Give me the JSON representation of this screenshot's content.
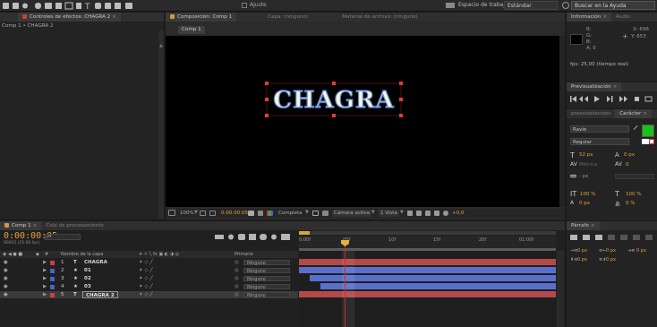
{
  "menubar": {
    "workspace_label": "Espacio de trabajo:",
    "workspace_value": "Estándar",
    "snap_label": "Ajuste",
    "search_placeholder": "Buscar en la Ayuda"
  },
  "effects_panel": {
    "tab_label": "Controles de efectos: CHAGRA 2",
    "breadcrumb": "Comp 1 • CHAGRA 2"
  },
  "composition_panel": {
    "tab_label": "Composición: Comp 1",
    "layer_tab": "Capa: (ninguno)",
    "footage_tab": "Material de archivo: (ninguno)",
    "comp_button": "Comp 1",
    "canvas_text": "CHAGRA",
    "toolbar": {
      "zoom": "100%",
      "timecode": "0:00:00:05",
      "resolution": "Completa",
      "camera": "Cámara activa",
      "views": "1 Vista",
      "exposure": "+0,0"
    }
  },
  "info_panel": {
    "tab_label": "Información",
    "audio_tab": "Audio",
    "r": "R:",
    "g": "G:",
    "b": "B:",
    "a": "A: 0",
    "x": "X: 696",
    "y": "Y: 653",
    "fps": "fps: 25,00 (tiempo real)"
  },
  "preview_panel": {
    "tab_label": "Previsualización"
  },
  "character_panel": {
    "tab_left": "preestablecidos",
    "tab_label": "Carácter",
    "font": "Ravie",
    "style": "Regular",
    "size": "52 px",
    "leading": "0 px",
    "kerning": "Métrica",
    "tracking": "0",
    "stroke": "- px",
    "vscale": "100 %",
    "hscale": "100 %",
    "baseline": "0 px",
    "tsume": "0 %",
    "fill_color": "#19c119"
  },
  "paragraph_panel": {
    "tab_label": "Párrafo",
    "indent_left": "0 px",
    "indent_right": "0 px",
    "indent_first": "0 px",
    "space_before": "0 px",
    "space_after": "0 px"
  },
  "timeline": {
    "tab_label": "Comp 1",
    "queue_tab": "Cola de procesamiento",
    "timecode": "0:00:00:05",
    "fps": "00005 (25.00 fps)",
    "col_name": "Nombre de la capa",
    "col_parent": "Primario",
    "ruler": [
      "0:00f",
      "05f",
      "10f",
      "15f",
      "20f",
      "01:00f"
    ],
    "layers": [
      {
        "num": "1",
        "name": "CHAGRA",
        "parent": "Ninguno",
        "color": "#c94040",
        "bar_color": "#b34a4a"
      },
      {
        "num": "2",
        "name": "01",
        "parent": "Ninguno",
        "color": "#4a62c9",
        "bar_color": "#5a6fcc"
      },
      {
        "num": "3",
        "name": "02",
        "parent": "Ninguno",
        "color": "#4a62c9",
        "bar_color": "#5a6fcc"
      },
      {
        "num": "4",
        "name": "03",
        "parent": "Ninguno",
        "color": "#4a62c9",
        "bar_color": "#5a6fcc"
      },
      {
        "num": "5",
        "name": "CHAGRA 2",
        "parent": "Ninguno",
        "color": "#c94040",
        "bar_color": "#b34a4a"
      }
    ]
  }
}
